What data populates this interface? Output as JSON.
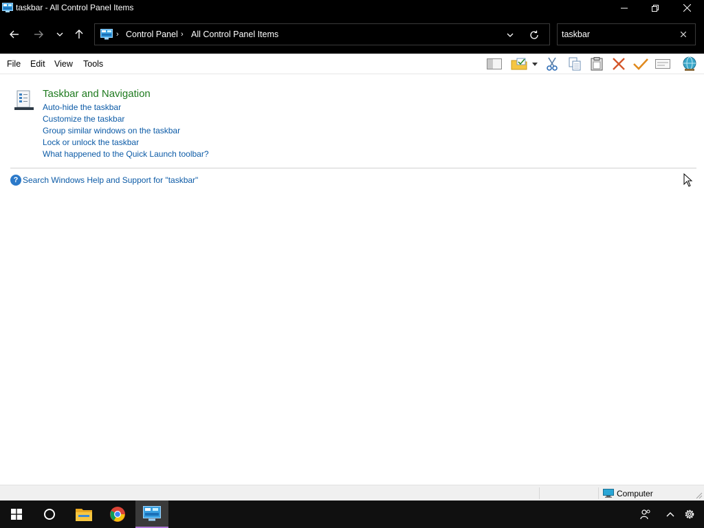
{
  "window": {
    "title": "taskbar - All Control Panel Items"
  },
  "navigation": {
    "breadcrumb": [
      "Control Panel",
      "All Control Panel Items"
    ],
    "search_value": "taskbar"
  },
  "menubar": {
    "items": [
      "File",
      "Edit",
      "View",
      "Tools"
    ]
  },
  "results": {
    "category_title": "Taskbar and Navigation",
    "tasks": [
      "Auto-hide the taskbar",
      "Customize the taskbar",
      "Group similar windows on the taskbar",
      "Lock or unlock the taskbar",
      "What happened to the Quick Launch toolbar?"
    ],
    "help_link": "Search Windows Help and Support for \"taskbar\""
  },
  "statusbar": {
    "location": "Computer"
  },
  "colors": {
    "category_green": "#1e7a1e",
    "link_blue": "#0b5aa6",
    "chrome_dark": "#000000",
    "taskbar_accent": "#b07ad8"
  },
  "icons": {
    "titlebar": "control-panel-icon",
    "toolbar": [
      "layout-pane-icon",
      "folder-check-icon",
      "cut-icon",
      "copy-icon",
      "paste-icon",
      "delete-icon",
      "apply-check-icon",
      "properties-icon",
      "globe-icon"
    ],
    "taskbar": [
      "windows-start-icon",
      "cortana-circle-icon",
      "file-explorer-icon",
      "chrome-icon",
      "control-panel-icon"
    ],
    "tray": [
      "people-icon",
      "chevron-up-icon",
      "settings-gear-icon"
    ]
  }
}
